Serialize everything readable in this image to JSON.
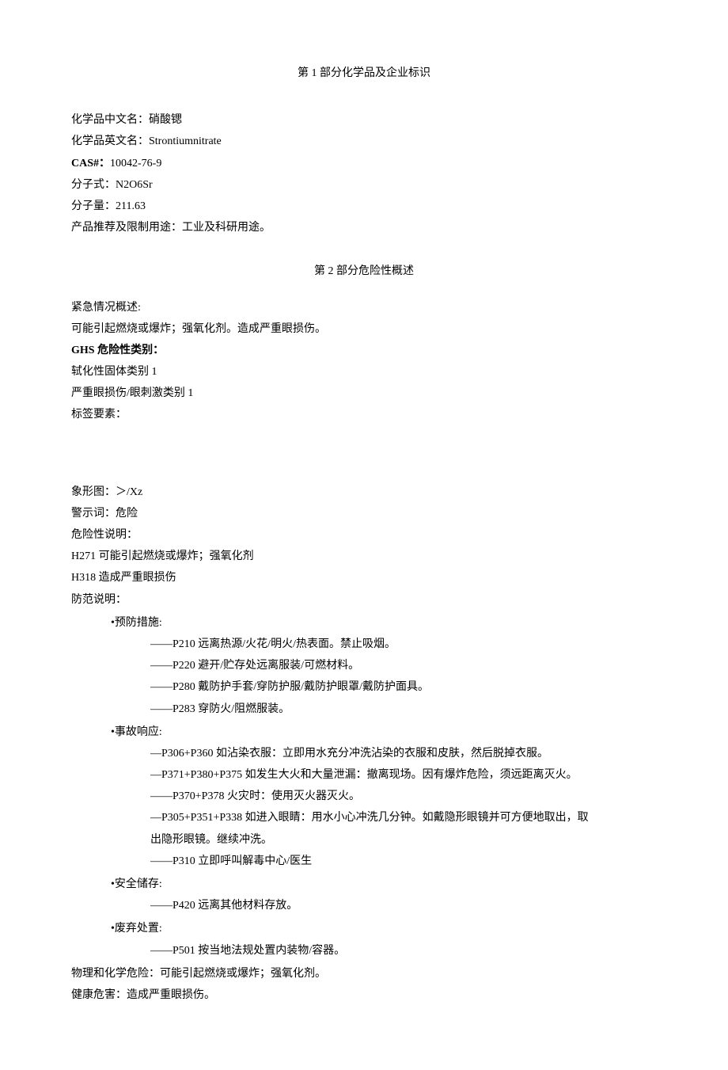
{
  "section1": {
    "title": "第 1 部分化学品及企业标识",
    "name_cn_label": "化学品中文名：",
    "name_cn_value": "硝酸锶",
    "name_en_label": "化学品英文名：",
    "name_en_value": "Strontiumnitrate",
    "cas_label": "CAS#：",
    "cas_value": "10042-76-9",
    "formula_label": "分子式：",
    "formula_value": "N2O6Sr",
    "weight_label": "分子量：",
    "weight_value": "211.63",
    "usage_label": "产品推荐及限制用途：",
    "usage_value": "工业及科研用途。"
  },
  "section2": {
    "title": "第 2 部分危险性概述",
    "emergency_label": "紧急情况概述:",
    "emergency_text": "可能引起燃烧或爆炸；强氧化剂。造成严重眼损伤。",
    "ghs_label": "GHS 危险性类别：",
    "ghs_class1": "轼化性固体类别 1",
    "ghs_class2": "严重眼损伤/眼刺激类别 1",
    "label_elements": "标签要素：",
    "pictogram_label": "象形图：",
    "pictogram_value": "＞/Xz",
    "signal_label": "警示词：",
    "signal_value": "危险",
    "hazard_label": "危险性说明：",
    "h271": "H271 可能引起燃烧或爆炸；强氧化剂",
    "h318": "H318 造成严重眼损伤",
    "precaution_label": "防范说明：",
    "prevention_header": "•预防措施:",
    "p210": "——P210 远离热源/火花/明火/热表面。禁止吸烟。",
    "p220": "——P220 避开/贮存处远离服装/可燃材料。",
    "p280": "——P280 戴防护手套/穿防护服/戴防护眼罩/戴防护面具。",
    "p283": "——P283 穿防火/阻燃服装。",
    "response_header": "•事故响应:",
    "p306_p360": "—P306+P360 如沾染衣服：立即用水充分冲洗沾染的衣服和皮肤，然后脱掉衣服。",
    "p371_p380_p375": "—P371+P380+P375 如发生大火和大量泄漏：撤离现场。因有爆炸危险，须远距离灭火。",
    "p370_p378": "——P370+P378 火灾时：使用灭火器灭火。",
    "p305_p351_p338_line1": "—P305+P351+P338 如进入眼睛：用水小心冲洗几分钟。如戴隐形眼镜并可方便地取出，取",
    "p305_p351_p338_line2": "出隐形眼镜。继续冲洗。",
    "p310": "——P310 立即呼叫解毒中心/医生",
    "storage_header": "•安全储存:",
    "p420": "——P420 远离其他材料存放。",
    "disposal_header": "•废弃处置:",
    "p501": "——P501 按当地法规处置内装物/容器。",
    "phys_chem_label": "物理和化学危险：",
    "phys_chem_value": "可能引起燃烧或爆炸；强氧化剂。",
    "health_label": "健康危害：",
    "health_value": "造成严重眼损伤。"
  }
}
